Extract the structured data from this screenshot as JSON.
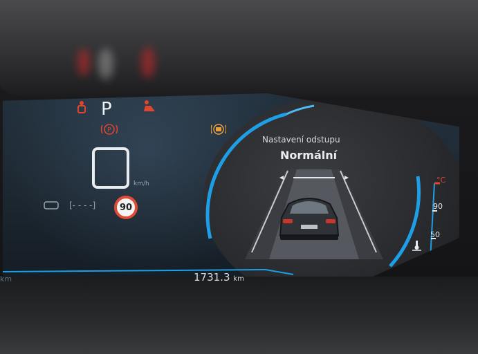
{
  "cluster": {
    "gear": "P",
    "speed_unit": "km/h",
    "speed_limit": "90",
    "odometer_value": "1731.3",
    "odometer_unit": "km",
    "trip_unit": "km",
    "acc_title": "Nastavení odstupu",
    "acc_value": "Normální",
    "temp_unit": "°C",
    "temp_high": "90",
    "temp_low": "50"
  },
  "colors": {
    "accent_blue": "#1e9ee6",
    "warning_red": "#e0452e",
    "warning_amber": "#e8a03a",
    "screen_bg": "#1f2a34"
  },
  "icons": [
    "seatbelt-warning-icon",
    "gear-indicator",
    "airbag-warning-icon",
    "parking-brake-icon",
    "adaptive-cruise-icon",
    "cruise-control-icon",
    "speed-limit-sign",
    "thermometer-icon"
  ]
}
